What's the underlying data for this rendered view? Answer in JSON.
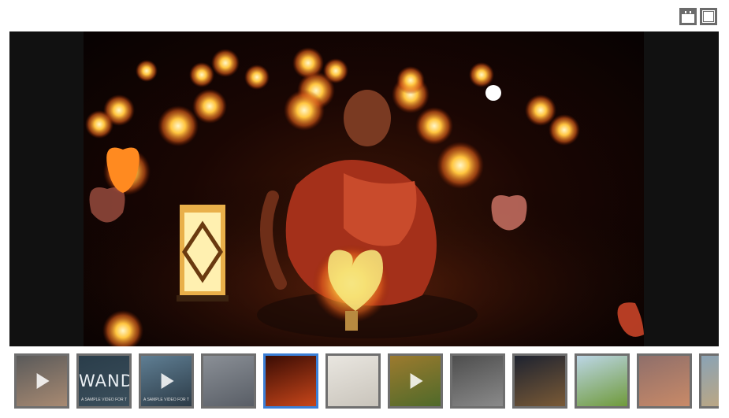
{
  "controls": {
    "filmstrip_toggle_icon": "filmstrip-icon",
    "fullscreen_icon": "fullscreen-icon"
  },
  "thumbnails": [
    {
      "name": "thumb-video-1",
      "kind": "video",
      "colors": [
        "#5a5a5a",
        "#a88a72"
      ],
      "active": false
    },
    {
      "name": "thumb-wand-video",
      "kind": "video-text",
      "text": "WAND",
      "caption": "A SAMPLE VIDEO FOR THE GALLERY PLUGIN",
      "colors": [
        "#2a3d4a",
        "#3b4f5c"
      ],
      "active": false
    },
    {
      "name": "thumb-video-3",
      "kind": "video",
      "caption": "A SAMPLE VIDEO FOR THE GALLERY PLUGIN",
      "colors": [
        "#5f7e93",
        "#2c3b47"
      ],
      "active": false
    },
    {
      "name": "thumb-big-ben",
      "kind": "image",
      "colors": [
        "#8a8f96",
        "#595e66"
      ],
      "active": false
    },
    {
      "name": "thumb-monk-lanterns",
      "kind": "image",
      "colors": [
        "#3a0c04",
        "#c8461a"
      ],
      "active": true
    },
    {
      "name": "thumb-puppies",
      "kind": "image",
      "colors": [
        "#e9e6e0",
        "#c9c4bb"
      ],
      "active": false
    },
    {
      "name": "thumb-tiger-video",
      "kind": "video",
      "colors": [
        "#9c7a2e",
        "#4f6a2a"
      ],
      "active": false
    },
    {
      "name": "thumb-city-bw",
      "kind": "image",
      "colors": [
        "#4e4e4e",
        "#8a8a8a"
      ],
      "active": false
    },
    {
      "name": "thumb-fireworks",
      "kind": "image",
      "colors": [
        "#1e2330",
        "#7a5a36"
      ],
      "active": false
    },
    {
      "name": "thumb-field",
      "kind": "image",
      "colors": [
        "#bcd6e6",
        "#6f9a3a"
      ],
      "active": false
    },
    {
      "name": "thumb-bridge-sunset",
      "kind": "image",
      "colors": [
        "#8f6f6a",
        "#c98a68"
      ],
      "active": false
    },
    {
      "name": "thumb-partial",
      "kind": "image",
      "colors": [
        "#8aa3b5",
        "#c4a77a"
      ],
      "active": false
    }
  ]
}
